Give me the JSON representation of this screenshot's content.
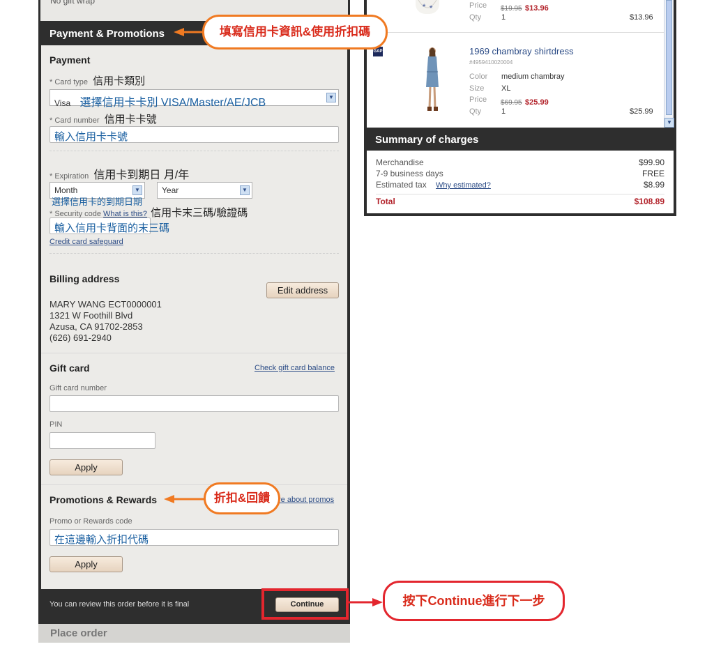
{
  "top_strip": {
    "gift_wrap_text": "No gift wrap"
  },
  "payment_panel": {
    "title": "Payment & Promotions",
    "payment": {
      "heading": "Payment",
      "card_type_label": "* Card type",
      "card_type_zh": "信用卡類別",
      "card_type_value": "Visa",
      "card_type_hint": "選擇信用卡卡別 VISA/Master/AE/JCB",
      "card_number_label": "* Card number",
      "card_number_zh": "信用卡卡號",
      "card_number_value": "輸入信用卡卡號",
      "expiration_label": "* Expiration",
      "expiration_zh": "信用卡到期日 月/年",
      "month_value": "Month",
      "year_value": "Year",
      "expiration_hint": "選擇信用卡的到期日期",
      "security_code_label": "* Security code",
      "security_code_link": "What is this?",
      "security_code_zh": "信用卡末三碼/驗證碼",
      "security_code_value": "輸入信用卡背面的末三碼",
      "safeguard_link": "Credit card safeguard"
    },
    "billing": {
      "heading": "Billing address",
      "edit_button": "Edit address",
      "lines": [
        "MARY WANG ECT0000001",
        "1321 W Foothill Blvd",
        "Azusa, CA   91702-2853",
        "(626) 691-2940"
      ]
    },
    "gift_card": {
      "heading": "Gift card",
      "check_balance_link": "Check gift card balance",
      "number_label": "Gift card number",
      "number_value": "",
      "pin_label": "PIN",
      "pin_value": "",
      "apply_button": "Apply"
    },
    "promotions": {
      "heading": "Promotions & Rewards",
      "about_link": "re about promos",
      "code_label": "Promo or Rewards code",
      "code_value": "在這邊輸入折扣代碼",
      "apply_button": "Apply"
    },
    "footer": {
      "review_text": "You can review this order before it is final",
      "continue_button": "Continue"
    }
  },
  "place_order": {
    "label": "Place order"
  },
  "order_items": [
    {
      "price_label": "Price",
      "price_old": "$19.95",
      "price_new": "$13.96",
      "qty_label": "Qty",
      "qty": "1",
      "total": "$13.96"
    },
    {
      "brand": "GAP",
      "name": "1969 chambray shirtdress",
      "sku": "#4959410020004",
      "color_label": "Color",
      "color": "medium chambray",
      "size_label": "Size",
      "size": "XL",
      "price_label": "Price",
      "price_old": "$69.95",
      "price_new": "$25.99",
      "qty_label": "Qty",
      "qty": "1",
      "total": "$25.99"
    }
  ],
  "summary": {
    "title": "Summary of charges",
    "merchandise_label": "Merchandise",
    "merchandise": "$99.90",
    "shipping_label": "7-9 business days",
    "shipping": "FREE",
    "tax_label": "Estimated tax",
    "tax_link": "Why estimated?",
    "tax": "$8.99",
    "total_label": "Total",
    "total": "$108.89"
  },
  "annotations": {
    "payment_note": "填寫信用卡資訊&使用折扣碼",
    "promo_note": "折扣&回饋",
    "continue_note": "按下Continue進行下一步"
  },
  "colors": {
    "panel_dark": "#2e2e2e",
    "panel_light": "#ecebe8",
    "price_red": "#b2222a",
    "link_blue": "#2c4c86",
    "callout_orange": "#f07a22",
    "callout_red": "#e3262e"
  }
}
